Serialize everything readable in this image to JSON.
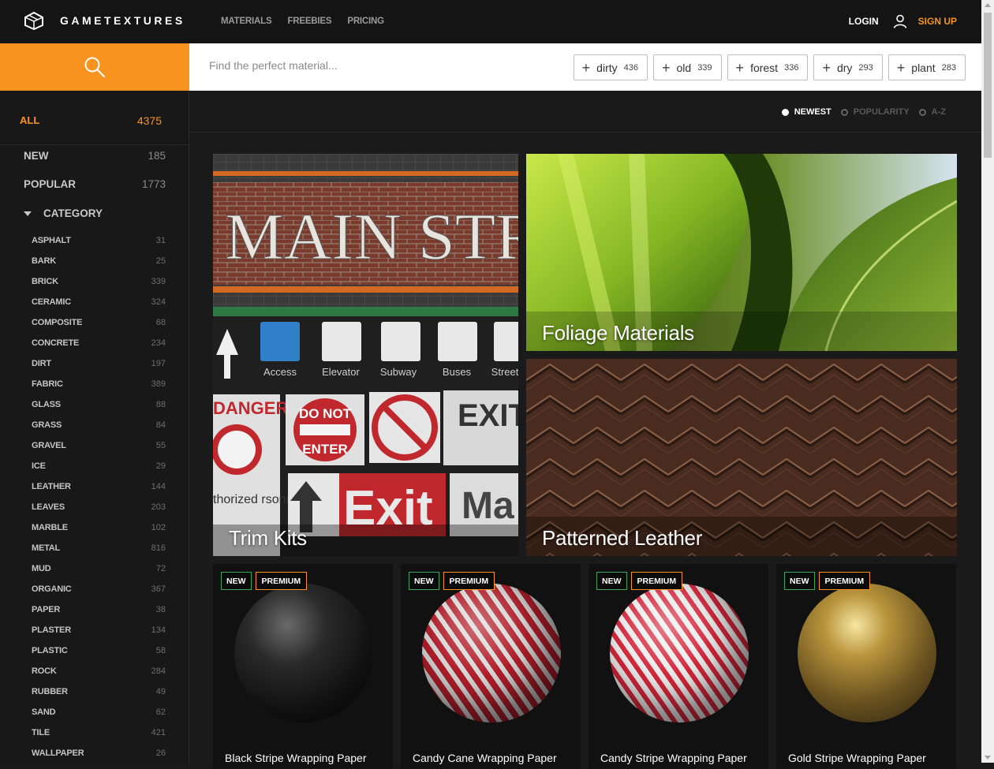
{
  "brand": {
    "name": "GAMETEXTURES",
    "icon": "box-logo-icon"
  },
  "nav": {
    "materials": "MATERIALS",
    "freebies": "FREEBIES",
    "pricing": "PRICING"
  },
  "auth": {
    "login": "LOGIN",
    "signup": "SIGN UP"
  },
  "search": {
    "placeholder": "Find the perfect material..."
  },
  "tags": [
    {
      "label": "dirty",
      "count": "436"
    },
    {
      "label": "old",
      "count": "339"
    },
    {
      "label": "forest",
      "count": "336"
    },
    {
      "label": "dry",
      "count": "293"
    },
    {
      "label": "plant",
      "count": "283"
    }
  ],
  "sidebar": {
    "all": {
      "label": "ALL",
      "count": "4375"
    },
    "new": {
      "label": "NEW",
      "count": "185"
    },
    "popular": {
      "label": "POPULAR",
      "count": "1773"
    },
    "category_label": "CATEGORY",
    "categories": [
      {
        "label": "ASPHALT",
        "count": "31"
      },
      {
        "label": "BARK",
        "count": "25"
      },
      {
        "label": "BRICK",
        "count": "339"
      },
      {
        "label": "CERAMIC",
        "count": "324"
      },
      {
        "label": "COMPOSITE",
        "count": "68"
      },
      {
        "label": "CONCRETE",
        "count": "234"
      },
      {
        "label": "DIRT",
        "count": "197"
      },
      {
        "label": "FABRIC",
        "count": "389"
      },
      {
        "label": "GLASS",
        "count": "88"
      },
      {
        "label": "GRASS",
        "count": "84"
      },
      {
        "label": "GRAVEL",
        "count": "55"
      },
      {
        "label": "ICE",
        "count": "29"
      },
      {
        "label": "LEATHER",
        "count": "144"
      },
      {
        "label": "LEAVES",
        "count": "203"
      },
      {
        "label": "MARBLE",
        "count": "102"
      },
      {
        "label": "METAL",
        "count": "816"
      },
      {
        "label": "MUD",
        "count": "72"
      },
      {
        "label": "ORGANIC",
        "count": "367"
      },
      {
        "label": "PAPER",
        "count": "38"
      },
      {
        "label": "PLASTER",
        "count": "134"
      },
      {
        "label": "PLASTIC",
        "count": "58"
      },
      {
        "label": "ROCK",
        "count": "284"
      },
      {
        "label": "RUBBER",
        "count": "49"
      },
      {
        "label": "SAND",
        "count": "62"
      },
      {
        "label": "TILE",
        "count": "421"
      },
      {
        "label": "WALLPAPER",
        "count": "26"
      }
    ]
  },
  "sort": {
    "newest": "NEWEST",
    "popularity": "POPULARITY",
    "az": "A-Z",
    "selected": "NEWEST"
  },
  "collections": {
    "trim": {
      "title": "Trim Kits",
      "sign_main": "MAIN STR",
      "signs": [
        "Access",
        "Elevator",
        "Subway",
        "Buses",
        "Street"
      ],
      "danger": "DANGER",
      "do_not": "DO NOT",
      "enter": "ENTER",
      "exit_and": "EXIT AND",
      "exit": "Exit",
      "ma": "Ma",
      "authorized": "thorized rsonnel ly"
    },
    "foliage": {
      "title": "Foliage Materials"
    },
    "leather": {
      "title": "Patterned Leather"
    }
  },
  "products": [
    {
      "name": "Black Stripe Wrapping Paper",
      "new": "NEW",
      "premium": "PREMIUM"
    },
    {
      "name": "Candy Cane Wrapping Paper",
      "new": "NEW",
      "premium": "PREMIUM"
    },
    {
      "name": "Candy Stripe Wrapping Paper",
      "new": "NEW",
      "premium": "PREMIUM"
    },
    {
      "name": "Gold Stripe Wrapping Paper",
      "new": "NEW",
      "premium": "PREMIUM"
    }
  ],
  "colors": {
    "accent": "#f7931e",
    "new_badge": "#3aa55b",
    "background": "#1a1a1a"
  }
}
